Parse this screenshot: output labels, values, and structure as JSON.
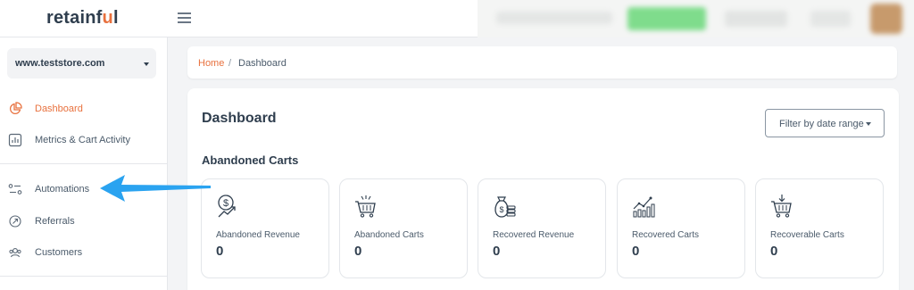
{
  "header": {
    "logo_text": "retainf",
    "logo_accent": "u",
    "logo_tail": "l"
  },
  "sidebar": {
    "store_selector": "www.teststore.com",
    "items": [
      {
        "label": "Dashboard",
        "icon": "dashboard-icon",
        "active": true
      },
      {
        "label": "Metrics & Cart Activity",
        "icon": "metrics-icon",
        "active": false
      },
      {
        "label": "Automations",
        "icon": "automations-icon",
        "active": false
      },
      {
        "label": "Referrals",
        "icon": "referrals-icon",
        "active": false
      },
      {
        "label": "Customers",
        "icon": "customers-icon",
        "active": false
      }
    ]
  },
  "breadcrumb": {
    "home": "Home",
    "separator": "/",
    "current": "Dashboard"
  },
  "main": {
    "title": "Dashboard",
    "filter_label": "Filter by date range",
    "section_title": "Abandoned Carts",
    "stats": [
      {
        "label": "Abandoned Revenue",
        "value": "0",
        "icon": "revenue-dollar-icon"
      },
      {
        "label": "Abandoned Carts",
        "value": "0",
        "icon": "cart-icon"
      },
      {
        "label": "Recovered Revenue",
        "value": "0",
        "icon": "money-bag-icon"
      },
      {
        "label": "Recovered Carts",
        "value": "0",
        "icon": "growth-chart-icon"
      },
      {
        "label": "Recoverable Carts",
        "value": "0",
        "icon": "cart-download-icon"
      }
    ]
  },
  "colors": {
    "accent": "#e8713e",
    "text": "#2f3e4e",
    "annotation_arrow": "#2aa3f0"
  }
}
